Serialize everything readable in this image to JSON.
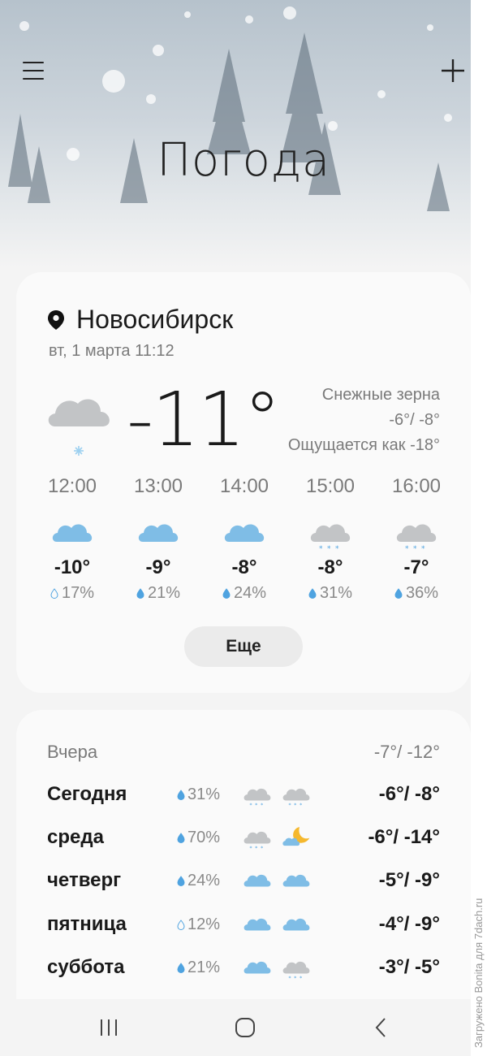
{
  "header": {
    "title": "Погода",
    "menu_icon": "hamburger-menu-icon",
    "add_icon": "plus-icon"
  },
  "current": {
    "location_icon": "location-pin-icon",
    "city": "Новосибирск",
    "datetime": "вт, 1 марта 11:12",
    "temperature": "-11°",
    "condition": "Снежные зерна",
    "high_low": "-6°/ -8°",
    "feels_like": "Ощущается как -18°",
    "icon": "snow-grains-icon"
  },
  "hourly": [
    {
      "time": "12:00",
      "temp": "-10°",
      "precip": "17%",
      "icon": "cloudy-icon"
    },
    {
      "time": "13:00",
      "temp": "-9°",
      "precip": "21%",
      "icon": "cloudy-icon"
    },
    {
      "time": "14:00",
      "temp": "-8°",
      "precip": "24%",
      "icon": "cloudy-icon"
    },
    {
      "time": "15:00",
      "temp": "-8°",
      "precip": "31%",
      "icon": "snow-icon"
    },
    {
      "time": "16:00",
      "temp": "-7°",
      "precip": "36%",
      "icon": "snow-icon"
    }
  ],
  "more_button": "Еще",
  "daily": {
    "yesterday": {
      "day": "Вчера",
      "temps": "-7°/ -12°"
    },
    "days": [
      {
        "day": "Сегодня",
        "precip": "31%",
        "icon_day": "snow-icon",
        "icon_night": "snow-icon",
        "temps": "-6°/ -8°"
      },
      {
        "day": "среда",
        "precip": "70%",
        "icon_day": "snow-icon",
        "icon_night": "partly-cloudy-night-icon",
        "temps": "-6°/ -14°"
      },
      {
        "day": "четверг",
        "precip": "24%",
        "icon_day": "cloudy-icon",
        "icon_night": "cloudy-icon",
        "temps": "-5°/ -9°"
      },
      {
        "day": "пятница",
        "precip": "12%",
        "icon_day": "cloudy-icon",
        "icon_night": "cloudy-icon",
        "temps": "-4°/ -9°"
      },
      {
        "day": "суббота",
        "precip": "21%",
        "icon_day": "cloudy-icon",
        "icon_night": "snow-icon",
        "temps": "-3°/ -5°"
      }
    ]
  },
  "navbar": {
    "recents_icon": "recent-apps-icon",
    "home_icon": "home-icon",
    "back_icon": "back-icon"
  },
  "watermark": "Загружено Bonita для 7dach.ru",
  "colors": {
    "cloud_blue": "#7fbde6",
    "cloud_gray": "#c2c4c6",
    "snow_blue": "#4fa3e0",
    "moon": "#f5b82e",
    "text_primary": "#1a1a1a",
    "text_secondary": "#7a7a7a"
  }
}
